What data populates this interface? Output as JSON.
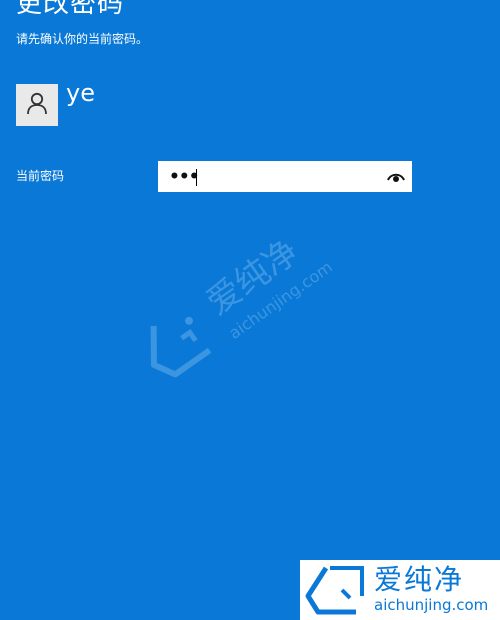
{
  "header": {
    "title": "更改密码",
    "subtitle": "请先确认你的当前密码。"
  },
  "account": {
    "avatar_icon": "person-icon",
    "username": "ye"
  },
  "password_field": {
    "label": "当前密码",
    "value": "•••",
    "reveal_icon": "eye-icon"
  },
  "watermark": {
    "brand_cn": "爱纯净",
    "brand_url": "aichunjing.com",
    "logo_icon": "aichunjing-logo-icon"
  },
  "colors": {
    "background": "#0a78d7",
    "text": "#ffffff",
    "input_bg": "#ffffff",
    "avatar_bg": "#e9e9e9"
  }
}
